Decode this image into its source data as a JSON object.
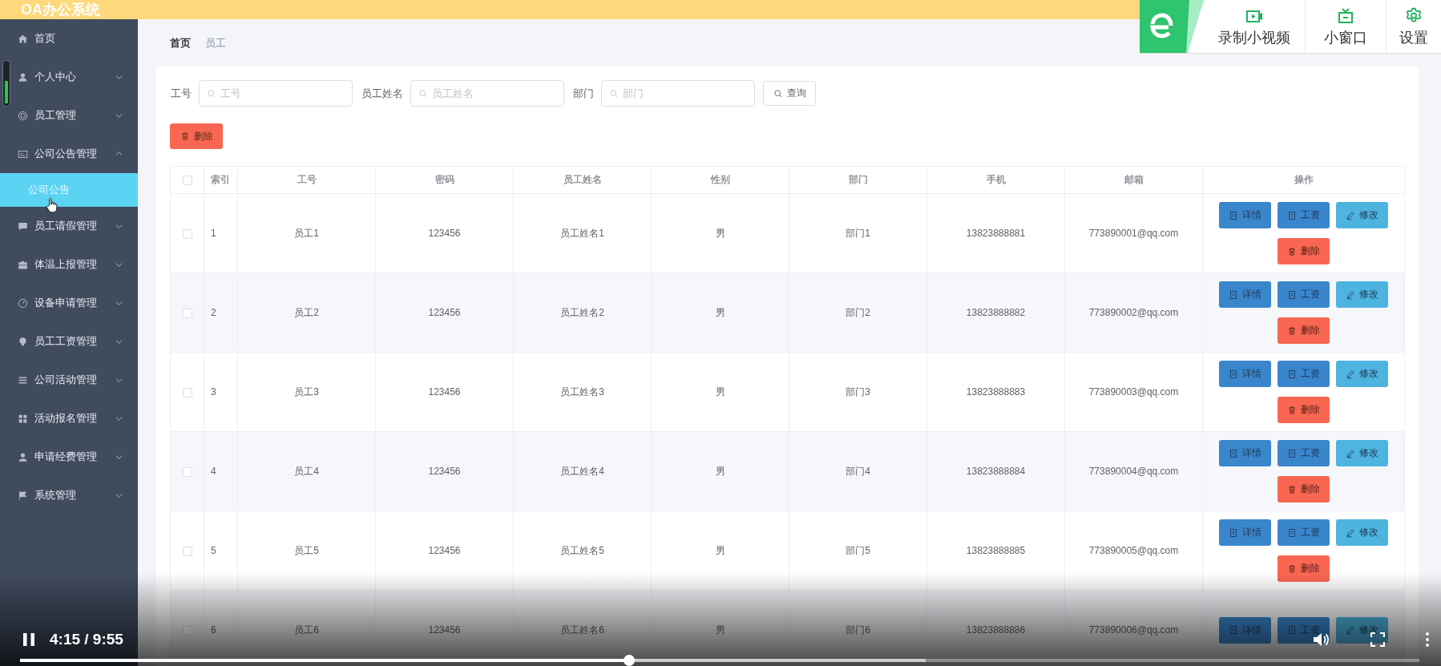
{
  "header": {
    "title": "OA办公系统"
  },
  "sidebar": {
    "items": [
      {
        "label": "首页",
        "kind": "link",
        "selected": false
      },
      {
        "label": "个人中心",
        "kind": "submenu",
        "expanded": false
      },
      {
        "label": "员工管理",
        "kind": "submenu",
        "expanded": false
      },
      {
        "label": "公司公告管理",
        "kind": "submenu",
        "expanded": true,
        "children": [
          {
            "label": "公司公告",
            "selected": true
          }
        ]
      },
      {
        "label": "员工请假管理",
        "kind": "submenu",
        "expanded": false
      },
      {
        "label": "体温上报管理",
        "kind": "submenu",
        "expanded": false
      },
      {
        "label": "设备申请管理",
        "kind": "submenu",
        "expanded": false
      },
      {
        "label": "员工工资管理",
        "kind": "submenu",
        "expanded": false
      },
      {
        "label": "公司活动管理",
        "kind": "submenu",
        "expanded": false
      },
      {
        "label": "活动报名管理",
        "kind": "submenu",
        "expanded": false
      },
      {
        "label": "申请经费管理",
        "kind": "submenu",
        "expanded": false
      },
      {
        "label": "系统管理",
        "kind": "submenu",
        "expanded": false
      }
    ]
  },
  "breadcrumb": [
    "首页",
    "员工"
  ],
  "search": {
    "fields": [
      {
        "label": "工号",
        "placeholder": "工号"
      },
      {
        "label": "员工姓名",
        "placeholder": "员工姓名"
      },
      {
        "label": "部门",
        "placeholder": "部门"
      }
    ],
    "button": "查询"
  },
  "toolbar": {
    "delete_button": "删除"
  },
  "table": {
    "all_checked": false,
    "columns": [
      "索引",
      "工号",
      "密码",
      "员工姓名",
      "性别",
      "部门",
      "手机",
      "邮箱",
      "操作"
    ],
    "rows": [
      {
        "checked": false,
        "cells": [
          "1",
          "员工1",
          "123456",
          "员工姓名1",
          "男",
          "部门1",
          "13823888881",
          "773890001@qq.com"
        ],
        "actions": [
          {
            "label": "详情",
            "kind": "detail"
          },
          {
            "label": "工资",
            "kind": "salary"
          },
          {
            "label": "修改",
            "kind": "edit"
          },
          {
            "label": "删除",
            "kind": "delete"
          }
        ]
      },
      {
        "checked": false,
        "cells": [
          "2",
          "员工2",
          "123456",
          "员工姓名2",
          "男",
          "部门2",
          "13823888882",
          "773890002@qq.com"
        ],
        "actions": [
          {
            "label": "详情",
            "kind": "detail"
          },
          {
            "label": "工资",
            "kind": "salary"
          },
          {
            "label": "修改",
            "kind": "edit"
          },
          {
            "label": "删除",
            "kind": "delete"
          }
        ]
      },
      {
        "checked": false,
        "cells": [
          "3",
          "员工3",
          "123456",
          "员工姓名3",
          "男",
          "部门3",
          "13823888883",
          "773890003@qq.com"
        ],
        "actions": [
          {
            "label": "详情",
            "kind": "detail"
          },
          {
            "label": "工资",
            "kind": "salary"
          },
          {
            "label": "修改",
            "kind": "edit"
          },
          {
            "label": "删除",
            "kind": "delete"
          }
        ]
      },
      {
        "checked": false,
        "cells": [
          "4",
          "员工4",
          "123456",
          "员工姓名4",
          "男",
          "部门4",
          "13823888884",
          "773890004@qq.com"
        ],
        "actions": [
          {
            "label": "详情",
            "kind": "detail"
          },
          {
            "label": "工资",
            "kind": "salary"
          },
          {
            "label": "修改",
            "kind": "edit"
          },
          {
            "label": "删除",
            "kind": "delete"
          }
        ]
      },
      {
        "checked": false,
        "cells": [
          "5",
          "员工5",
          "123456",
          "员工姓名5",
          "男",
          "部门5",
          "13823888885",
          "773890005@qq.com"
        ],
        "actions": [
          {
            "label": "详情",
            "kind": "detail"
          },
          {
            "label": "工资",
            "kind": "salary"
          },
          {
            "label": "修改",
            "kind": "edit"
          },
          {
            "label": "删除",
            "kind": "delete"
          }
        ]
      },
      {
        "checked": false,
        "cells": [
          "6",
          "员工6",
          "123456",
          "员工姓名6",
          "男",
          "部门6",
          "13823888886",
          "773890006@qq.com"
        ],
        "actions": [
          {
            "label": "详情",
            "kind": "detail"
          },
          {
            "label": "工资",
            "kind": "salary"
          },
          {
            "label": "修改",
            "kind": "edit"
          }
        ]
      }
    ]
  },
  "player": {
    "toolbar": [
      {
        "label": "录制小视频",
        "kind": "record"
      },
      {
        "label": "小窗口",
        "kind": "window"
      },
      {
        "label": "设置",
        "kind": "settings"
      }
    ],
    "playing": true,
    "time": "4:15 / 9:55",
    "progress": {
      "level": 0.435
    },
    "buffered": {
      "level": 0.647
    }
  }
}
